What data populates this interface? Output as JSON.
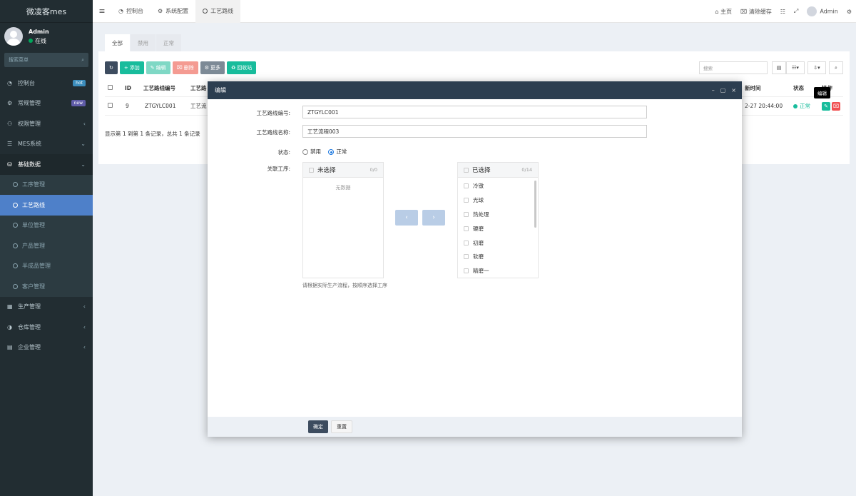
{
  "sidebar": {
    "logo": "微凌客mes",
    "user": {
      "name": "Admin",
      "status": "在线"
    },
    "search_placeholder": "搜索菜单",
    "items": [
      {
        "label": "控制台",
        "badge": "hot",
        "icon": "dashboard-icon"
      },
      {
        "label": "常规管理",
        "badge": "new",
        "icon": "cogs-icon"
      },
      {
        "label": "权限管理",
        "icon": "group-icon"
      },
      {
        "label": "MES系统",
        "icon": "list-icon"
      },
      {
        "label": "基础数据",
        "icon": "database-icon"
      }
    ],
    "sub_items": [
      "工序管理",
      "工艺路线",
      "单位管理",
      "产品管理",
      "半成品管理",
      "客户管理"
    ],
    "after_items": [
      {
        "label": "生产管理",
        "icon": "calendar-icon"
      },
      {
        "label": "仓库管理",
        "icon": "pie-icon"
      },
      {
        "label": "企业管理",
        "icon": "building-icon"
      }
    ]
  },
  "topbar": {
    "tabs": [
      "控制台",
      "系统配置",
      "工艺路线"
    ],
    "right": {
      "home": "主页",
      "clear_cache": "清除缓存",
      "user": "Admin"
    }
  },
  "panel": {
    "tabs": [
      "全部",
      "禁用",
      "正常"
    ],
    "toolbar": {
      "add": "添加",
      "edit": "编辑",
      "delete": "删除",
      "more": "更多",
      "recycle": "回收站"
    },
    "search_placeholder": "搜索",
    "columns": [
      "ID",
      "工艺路线编号",
      "工艺路",
      "新时间",
      "状态",
      "操作"
    ],
    "row": {
      "id": "9",
      "code": "ZTGYLC001",
      "name": "工艺流",
      "time": "2-27 20:44:00",
      "status": "正常"
    },
    "summary": "显示第 1 到第 1 条记录，总共 1 条记录",
    "tooltip": "编辑"
  },
  "modal": {
    "title": "编辑",
    "code_label": "工艺路线编号:",
    "code_value": "ZTGYLC001",
    "name_label": "工艺路线名称:",
    "name_value": "工艺流程003",
    "status_label": "状态:",
    "status_options": [
      "禁用",
      "正常"
    ],
    "status_selected": "正常",
    "process_label": "关联工序:",
    "left_box": {
      "title": "未选择",
      "count": "0/0",
      "empty": "无数据"
    },
    "right_box": {
      "title": "已选择",
      "count": "0/14",
      "items": [
        "冷镦",
        "光球",
        "热处理",
        "硬磨",
        "初磨",
        "软磨",
        "精磨一"
      ]
    },
    "hint": "请根据实际生产流程，按顺序选择工序",
    "confirm": "确定",
    "reset": "重置"
  },
  "colors": {
    "sidebar": "#222d32",
    "active": "#4e80c9",
    "modal_head": "#2c3e50",
    "green": "#18bc9c",
    "red": "#f05050"
  }
}
